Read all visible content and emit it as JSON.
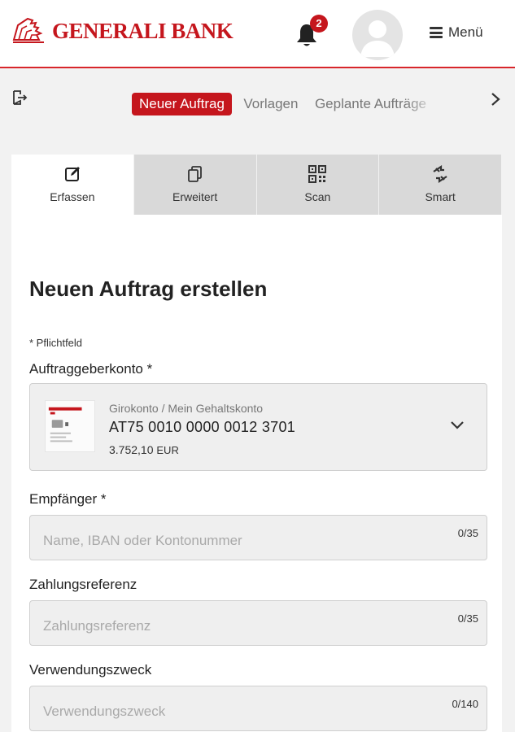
{
  "header": {
    "brand": "GENERALI BANK",
    "notification_count": "2",
    "menu_label": "Menü"
  },
  "subnav": {
    "tabs": [
      {
        "label": "Neuer Auftrag",
        "active": true
      },
      {
        "label": "Vorlagen",
        "active": false
      },
      {
        "label": "Geplante Aufträge",
        "active": false
      }
    ]
  },
  "mode_tabs": [
    {
      "label": "Erfassen",
      "icon": "edit-icon",
      "active": true
    },
    {
      "label": "Erweitert",
      "icon": "copy-icon",
      "active": false
    },
    {
      "label": "Scan",
      "icon": "qr-code-icon",
      "active": false
    },
    {
      "label": "Smart",
      "icon": "swap-arrows-icon",
      "active": false
    }
  ],
  "form": {
    "title": "Neuen Auftrag erstellen",
    "required_note": "* Pflichtfeld",
    "account": {
      "label": "Auftraggeberkonto *",
      "type": "Girokonto / Mein Gehaltskonto",
      "iban": "AT75 0010 0000 0012 3701",
      "balance": "3.752,10",
      "currency": "EUR"
    },
    "recipient": {
      "label": "Empfänger *",
      "placeholder": "Name, IBAN oder Kontonummer",
      "value": "",
      "counter": "0/35"
    },
    "reference": {
      "label": "Zahlungsreferenz",
      "placeholder": "Zahlungsreferenz",
      "value": "",
      "counter": "0/35"
    },
    "purpose": {
      "label": "Verwendungszweck",
      "placeholder": "Verwendungszweck",
      "value": "",
      "counter": "0/140"
    }
  },
  "colors": {
    "brand_red": "#c5161d",
    "background": "#f2f2f2",
    "inactive_tab": "#d9d9d9"
  }
}
